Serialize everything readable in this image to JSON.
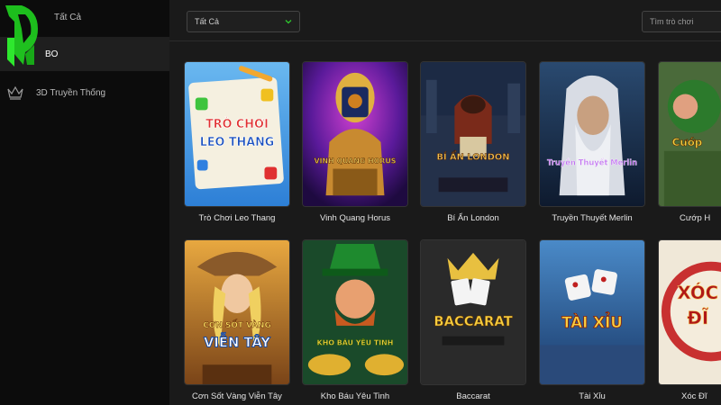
{
  "sidebar": {
    "items": [
      {
        "label": "Tất Cả",
        "icon": "grid-icon"
      },
      {
        "label": "Bo",
        "icon": "slot-icon"
      },
      {
        "label": "3D Truyền Thống",
        "icon": "crown-icon"
      }
    ]
  },
  "filter": {
    "selected": "Tất Cả"
  },
  "search": {
    "placeholder": "Tìm trò chơi"
  },
  "games": [
    {
      "title": "Trò Chơi Leo Thang",
      "art_text": [
        "TRÒ CHƠI",
        "LEO THANG"
      ]
    },
    {
      "title": "Vinh Quang Horus",
      "art_text": [
        "VINH QUANG HORUS"
      ]
    },
    {
      "title": "Bí Ẩn London",
      "art_text": [
        "BÍ ẨN LONDON"
      ]
    },
    {
      "title": "Truyền Thuyết Merlin",
      "art_text": [
        "Truyền Thuyết Merlin"
      ]
    },
    {
      "title": "Cướp H",
      "art_text": [
        "Cướp"
      ]
    },
    {
      "title": "Cơn Sốt Vàng Viễn Tây",
      "art_text": [
        "CƠN SỐT VÀNG",
        "VIỄN TÂY"
      ]
    },
    {
      "title": "Kho Báu Yêu Tinh",
      "art_text": [
        "KHO BÁU YÊU TINH"
      ]
    },
    {
      "title": "Baccarat",
      "art_text": [
        "BACCARAT"
      ]
    },
    {
      "title": "Tài Xỉu",
      "art_text": [
        "TÀI XỈU"
      ]
    },
    {
      "title": "Xóc Đĩ",
      "art_text": [
        "XÓC",
        "ĐĨ"
      ]
    }
  ],
  "colors": {
    "sidebar_bg": "#0c0c0c",
    "main_bg": "#1a1a1a",
    "logo_green": "#2ee82e"
  }
}
